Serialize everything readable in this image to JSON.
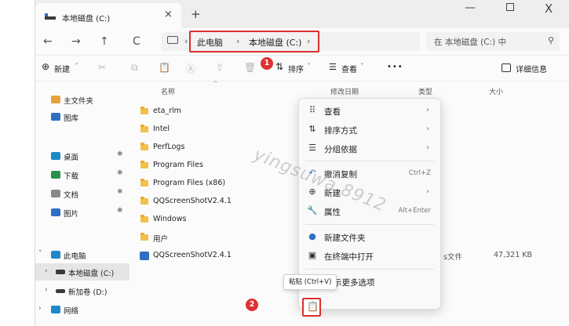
{
  "window": {
    "tab_title": "本地磁盘 (C:)",
    "tab_close": "×",
    "tab_new": "+",
    "minimize": "—",
    "close": "X",
    "colors": {
      "accent": "#2d6fc4",
      "highlight_box": "#d93030",
      "folder": "#f2c04b"
    }
  },
  "nav": {
    "back": "←",
    "forward": "→",
    "up": "↑",
    "refresh": "C",
    "breadcrumb": [
      "此电脑",
      "本地磁盘 (C:)"
    ],
    "chev": "›",
    "search_placeholder": "在 本地磁盘 (C:) 中",
    "search_icon_glyph": "⚲"
  },
  "toolbar": {
    "new_label": "新建",
    "new_glyph": "⊕",
    "sort_label": "排序",
    "view_label": "查看",
    "more": "•••",
    "details_label": "详细信息",
    "cut_glyph": "✂",
    "copy_glyph": "⧉",
    "paste_glyph": "📋",
    "rename_glyph": "Ⓐ",
    "share_glyph": "⇪",
    "delete_glyph": "🗑",
    "badge_1": "1",
    "dropdown": "˅"
  },
  "sidebar": {
    "items": [
      {
        "label": "主文件夹",
        "pinned": false
      },
      {
        "label": "图库",
        "pinned": false
      },
      {
        "label": "桌面",
        "pinned": true
      },
      {
        "label": "下载",
        "pinned": true
      },
      {
        "label": "文档",
        "pinned": true
      },
      {
        "label": "图片",
        "pinned": true
      },
      {
        "label": "此电脑",
        "pinned": false
      },
      {
        "label": "本地磁盘 (C:)",
        "pinned": false
      },
      {
        "label": "新加卷 (D:)",
        "pinned": false
      },
      {
        "label": "网络",
        "pinned": false
      }
    ],
    "pin_glyph": "✱",
    "expand_glyph": "›",
    "expanded_glyph": "˅"
  },
  "list": {
    "columns": {
      "name": "名称",
      "date": "修改日期",
      "type": "类型",
      "size": "大小"
    },
    "sort_arrow": "^",
    "rows": [
      {
        "name": "eta_rlm",
        "kind": "folder",
        "type": "",
        "size": ""
      },
      {
        "name": "Intel",
        "kind": "folder",
        "type": "",
        "size": ""
      },
      {
        "name": "PerfLogs",
        "kind": "folder",
        "type": "",
        "size": ""
      },
      {
        "name": "Program Files",
        "kind": "folder",
        "type": "",
        "size": ""
      },
      {
        "name": "Program Files (x86)",
        "kind": "folder",
        "type": "",
        "size": ""
      },
      {
        "name": "QQScreenShotV2.4.1",
        "kind": "folder",
        "type": "",
        "size": ""
      },
      {
        "name": "Windows",
        "kind": "folder",
        "type": "",
        "size": ""
      },
      {
        "name": "用户",
        "kind": "folder",
        "type": "",
        "size": ""
      },
      {
        "name": "QQScreenShotV2.4.1",
        "kind": "app",
        "type": "s文件",
        "size": "47,321 KB"
      }
    ]
  },
  "context_menu": {
    "items": [
      {
        "icon": "⠿",
        "label": "查看",
        "shortcut": "",
        "submenu": true
      },
      {
        "icon": "⇅",
        "label": "排序方式",
        "shortcut": "",
        "submenu": true
      },
      {
        "icon": "☰",
        "label": "分组依据",
        "shortcut": "",
        "submenu": true
      },
      {
        "icon": "↶",
        "label": "撤消复制",
        "shortcut": "Ctrl+Z",
        "submenu": false
      },
      {
        "icon": "⊕",
        "label": "新建",
        "shortcut": "",
        "submenu": true
      },
      {
        "icon": "🔧",
        "label": "属性",
        "shortcut": "Alt+Enter",
        "submenu": false
      },
      {
        "icon": "●",
        "label": "新建文件夹",
        "shortcut": "",
        "submenu": false
      },
      {
        "icon": "▣",
        "label": "在终端中打开",
        "shortcut": "",
        "submenu": false
      },
      {
        "icon": "",
        "label": "示更多选项",
        "shortcut": "",
        "submenu": false
      }
    ],
    "arrow": "›",
    "tooltip": "粘贴 (Ctrl+V)",
    "badge_2": "2",
    "paste_glyph": "📋"
  },
  "watermark": "yingsuwa  8912"
}
